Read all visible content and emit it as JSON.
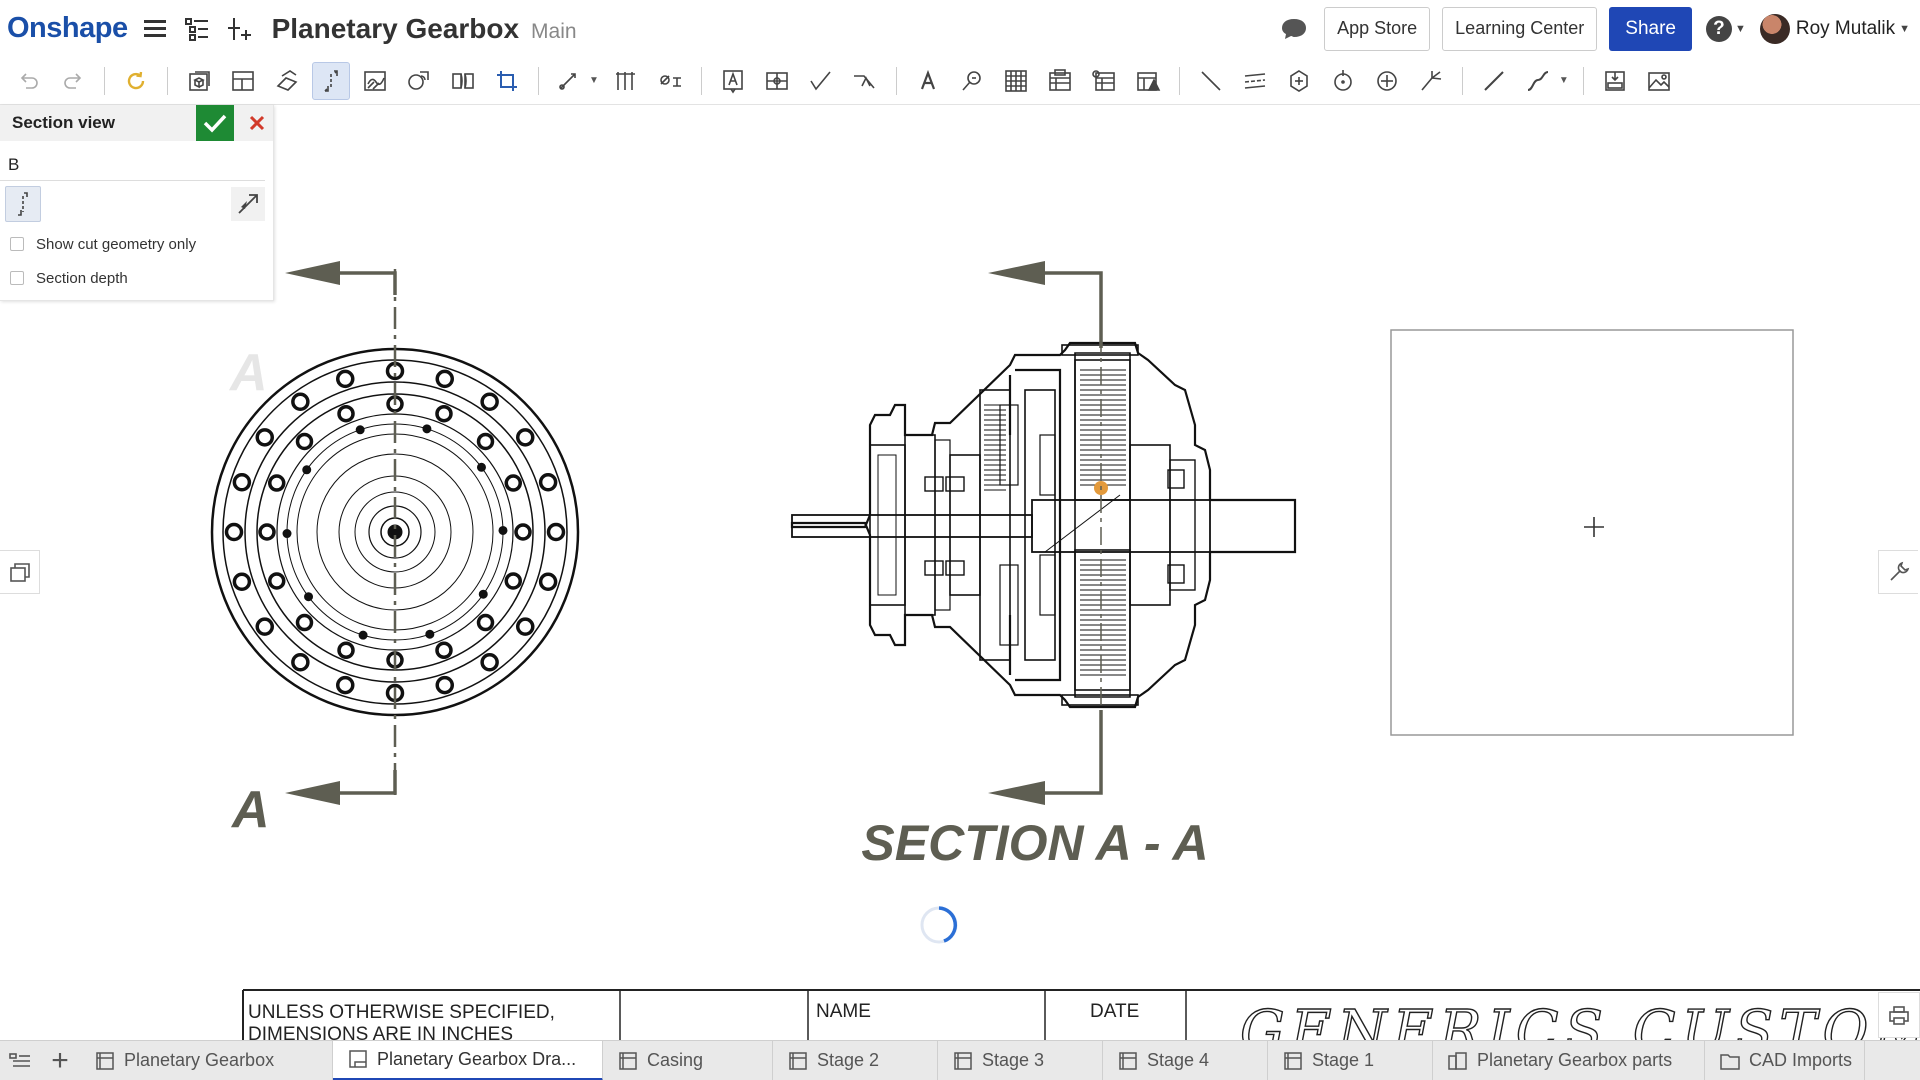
{
  "header": {
    "logo": "Onshape",
    "title": "Planetary Gearbox",
    "branch": "Main",
    "app_store": "App Store",
    "learning_center": "Learning Center",
    "share": "Share",
    "help": "?",
    "user_name": "Roy Mutalik"
  },
  "toolbar": {
    "icons": [
      "undo-icon",
      "redo-icon",
      "regenerate-icon",
      "insert-view-icon",
      "projected-view-icon",
      "auxiliary-view-icon",
      "section-view-icon",
      "broken-out-section-icon",
      "detail-view-icon",
      "break-view-icon",
      "crop-view-icon",
      "dimension-icon",
      "ordinate-dimension-icon",
      "hole-callout-icon",
      "note-icon",
      "datum-icon",
      "surface-finish-icon",
      "weld-symbol-icon",
      "text-icon",
      "inspection-symbol-icon",
      "table-icon",
      "bom-icon",
      "hole-table-icon",
      "revision-table-icon",
      "line-icon",
      "centerline-icon",
      "centermark-icon",
      "circle-centermark-icon",
      "point-icon",
      "balloon-icon",
      "sketch-line-icon",
      "spline-icon",
      "export-icon",
      "image-icon"
    ]
  },
  "section_panel": {
    "title": "Section view",
    "label": "B",
    "show_cut_geometry_only": "Show cut geometry only",
    "section_depth": "Section depth"
  },
  "drawing": {
    "label_left_top": "A",
    "label_left_bottom": "A",
    "section_caption": "SECTION A - A",
    "title_block": {
      "notes": "UNLESS OTHERWISE SPECIFIED, DIMENSIONS ARE IN INCHES",
      "name_header": "NAME",
      "date_header": "DATE",
      "company": "GENERICS CUSTOM"
    }
  },
  "tabs": [
    {
      "label": "Planetary Gearbox",
      "icon": "part-studio-icon"
    },
    {
      "label": "Planetary Gearbox Dra...",
      "icon": "drawing-icon",
      "active": true
    },
    {
      "label": "Casing",
      "icon": "part-studio-icon"
    },
    {
      "label": "Stage 2",
      "icon": "part-studio-icon"
    },
    {
      "label": "Stage 3",
      "icon": "part-studio-icon"
    },
    {
      "label": "Stage 4",
      "icon": "part-studio-icon"
    },
    {
      "label": "Stage 1",
      "icon": "part-studio-icon"
    },
    {
      "label": "Planetary Gearbox parts",
      "icon": "assembly-icon"
    },
    {
      "label": "CAD Imports",
      "icon": "folder-icon"
    }
  ],
  "colors": {
    "brand": "#1a4fa8",
    "share": "#1f47b5",
    "confirm": "#1e8a34",
    "cancel": "#d23a2a",
    "arrow": "#5e5e52",
    "spinner": "#2b6fd6",
    "gear_center": "#e39a3c"
  }
}
